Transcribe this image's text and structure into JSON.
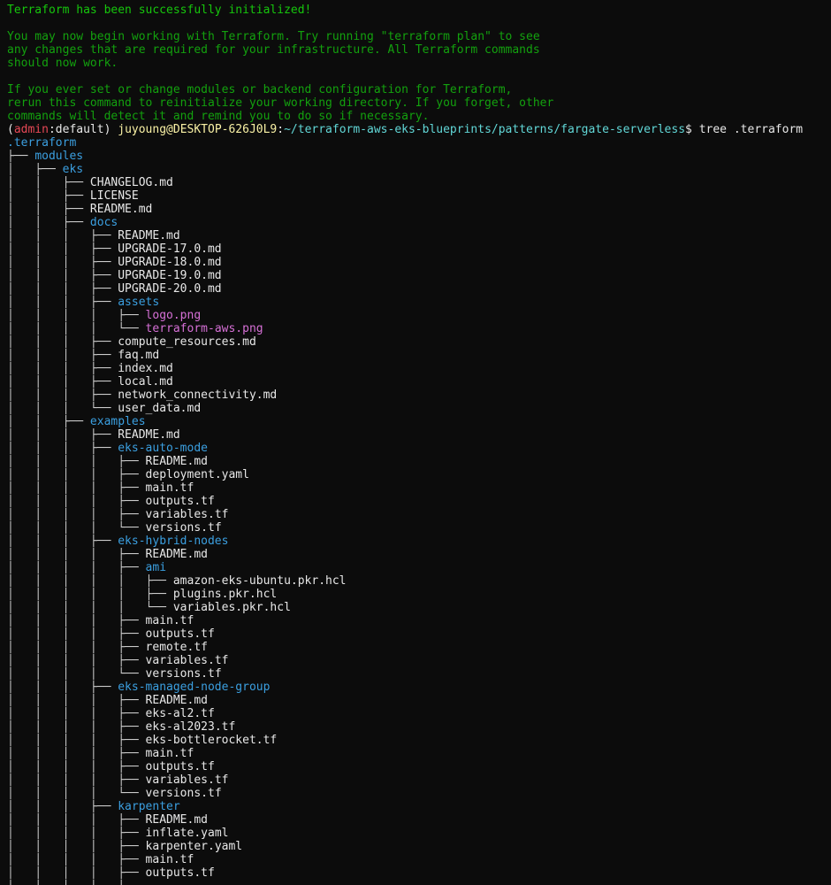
{
  "colors": {
    "background": "#0c0c0c",
    "success_text": "#16c60c",
    "info_text": "#13a10e",
    "directory": "#3b9fe0",
    "image_file": "#d670d6",
    "admin_red": "#e74856",
    "user_host": "#f9f1a5",
    "path": "#61d6d6"
  },
  "init_message": [
    "Terraform has been successfully initialized!",
    "",
    "You may now begin working with Terraform. Try running \"terraform plan\" to see",
    "any changes that are required for your infrastructure. All Terraform commands",
    "should now work.",
    "",
    "If you ever set or change modules or backend configuration for Terraform,",
    "rerun this command to reinitialize your working directory. If you forget, other",
    "commands will detect it and remind you to do so if necessary."
  ],
  "prompt": {
    "open_paren": "(",
    "admin": "admin",
    "colon": ":",
    "profile": "default",
    "close_paren": ") ",
    "user_host": "juyoung@DESKTOP-626J0L9",
    "colon2": ":",
    "path": "~/terraform-aws-eks-blueprints/patterns/fargate-serverless",
    "dollar": "$ ",
    "command": "tree .terraform"
  },
  "tree": [
    {
      "prefix": "",
      "name": ".terraform",
      "type": "dir"
    },
    {
      "prefix": "├── ",
      "name": "modules",
      "type": "dir"
    },
    {
      "prefix": "│   ├── ",
      "name": "eks",
      "type": "dir"
    },
    {
      "prefix": "│   │   ├── ",
      "name": "CHANGELOG.md",
      "type": "file"
    },
    {
      "prefix": "│   │   ├── ",
      "name": "LICENSE",
      "type": "file"
    },
    {
      "prefix": "│   │   ├── ",
      "name": "README.md",
      "type": "file"
    },
    {
      "prefix": "│   │   ├── ",
      "name": "docs",
      "type": "dir"
    },
    {
      "prefix": "│   │   │   ├── ",
      "name": "README.md",
      "type": "file"
    },
    {
      "prefix": "│   │   │   ├── ",
      "name": "UPGRADE-17.0.md",
      "type": "file"
    },
    {
      "prefix": "│   │   │   ├── ",
      "name": "UPGRADE-18.0.md",
      "type": "file"
    },
    {
      "prefix": "│   │   │   ├── ",
      "name": "UPGRADE-19.0.md",
      "type": "file"
    },
    {
      "prefix": "│   │   │   ├── ",
      "name": "UPGRADE-20.0.md",
      "type": "file"
    },
    {
      "prefix": "│   │   │   ├── ",
      "name": "assets",
      "type": "dir"
    },
    {
      "prefix": "│   │   │   │   ├── ",
      "name": "logo.png",
      "type": "img"
    },
    {
      "prefix": "│   │   │   │   └── ",
      "name": "terraform-aws.png",
      "type": "img"
    },
    {
      "prefix": "│   │   │   ├── ",
      "name": "compute_resources.md",
      "type": "file"
    },
    {
      "prefix": "│   │   │   ├── ",
      "name": "faq.md",
      "type": "file"
    },
    {
      "prefix": "│   │   │   ├── ",
      "name": "index.md",
      "type": "file"
    },
    {
      "prefix": "│   │   │   ├── ",
      "name": "local.md",
      "type": "file"
    },
    {
      "prefix": "│   │   │   ├── ",
      "name": "network_connectivity.md",
      "type": "file"
    },
    {
      "prefix": "│   │   │   └── ",
      "name": "user_data.md",
      "type": "file"
    },
    {
      "prefix": "│   │   ├── ",
      "name": "examples",
      "type": "dir"
    },
    {
      "prefix": "│   │   │   ├── ",
      "name": "README.md",
      "type": "file"
    },
    {
      "prefix": "│   │   │   ├── ",
      "name": "eks-auto-mode",
      "type": "dir"
    },
    {
      "prefix": "│   │   │   │   ├── ",
      "name": "README.md",
      "type": "file"
    },
    {
      "prefix": "│   │   │   │   ├── ",
      "name": "deployment.yaml",
      "type": "file"
    },
    {
      "prefix": "│   │   │   │   ├── ",
      "name": "main.tf",
      "type": "file"
    },
    {
      "prefix": "│   │   │   │   ├── ",
      "name": "outputs.tf",
      "type": "file"
    },
    {
      "prefix": "│   │   │   │   ├── ",
      "name": "variables.tf",
      "type": "file"
    },
    {
      "prefix": "│   │   │   │   └── ",
      "name": "versions.tf",
      "type": "file"
    },
    {
      "prefix": "│   │   │   ├── ",
      "name": "eks-hybrid-nodes",
      "type": "dir"
    },
    {
      "prefix": "│   │   │   │   ├── ",
      "name": "README.md",
      "type": "file"
    },
    {
      "prefix": "│   │   │   │   ├── ",
      "name": "ami",
      "type": "dir"
    },
    {
      "prefix": "│   │   │   │   │   ├── ",
      "name": "amazon-eks-ubuntu.pkr.hcl",
      "type": "file"
    },
    {
      "prefix": "│   │   │   │   │   ├── ",
      "name": "plugins.pkr.hcl",
      "type": "file"
    },
    {
      "prefix": "│   │   │   │   │   └── ",
      "name": "variables.pkr.hcl",
      "type": "file"
    },
    {
      "prefix": "│   │   │   │   ├── ",
      "name": "main.tf",
      "type": "file"
    },
    {
      "prefix": "│   │   │   │   ├── ",
      "name": "outputs.tf",
      "type": "file"
    },
    {
      "prefix": "│   │   │   │   ├── ",
      "name": "remote.tf",
      "type": "file"
    },
    {
      "prefix": "│   │   │   │   ├── ",
      "name": "variables.tf",
      "type": "file"
    },
    {
      "prefix": "│   │   │   │   └── ",
      "name": "versions.tf",
      "type": "file"
    },
    {
      "prefix": "│   │   │   ├── ",
      "name": "eks-managed-node-group",
      "type": "dir"
    },
    {
      "prefix": "│   │   │   │   ├── ",
      "name": "README.md",
      "type": "file"
    },
    {
      "prefix": "│   │   │   │   ├── ",
      "name": "eks-al2.tf",
      "type": "file"
    },
    {
      "prefix": "│   │   │   │   ├── ",
      "name": "eks-al2023.tf",
      "type": "file"
    },
    {
      "prefix": "│   │   │   │   ├── ",
      "name": "eks-bottlerocket.tf",
      "type": "file"
    },
    {
      "prefix": "│   │   │   │   ├── ",
      "name": "main.tf",
      "type": "file"
    },
    {
      "prefix": "│   │   │   │   ├── ",
      "name": "outputs.tf",
      "type": "file"
    },
    {
      "prefix": "│   │   │   │   ├── ",
      "name": "variables.tf",
      "type": "file"
    },
    {
      "prefix": "│   │   │   │   └── ",
      "name": "versions.tf",
      "type": "file"
    },
    {
      "prefix": "│   │   │   ├── ",
      "name": "karpenter",
      "type": "dir"
    },
    {
      "prefix": "│   │   │   │   ├── ",
      "name": "README.md",
      "type": "file"
    },
    {
      "prefix": "│   │   │   │   ├── ",
      "name": "inflate.yaml",
      "type": "file"
    },
    {
      "prefix": "│   │   │   │   ├── ",
      "name": "karpenter.yaml",
      "type": "file"
    },
    {
      "prefix": "│   │   │   │   ├── ",
      "name": "main.tf",
      "type": "file"
    },
    {
      "prefix": "│   │   │   │   ├── ",
      "name": "outputs.tf",
      "type": "file"
    },
    {
      "prefix": "│   │   │   │   ├── ",
      "name": "",
      "type": "file"
    }
  ]
}
